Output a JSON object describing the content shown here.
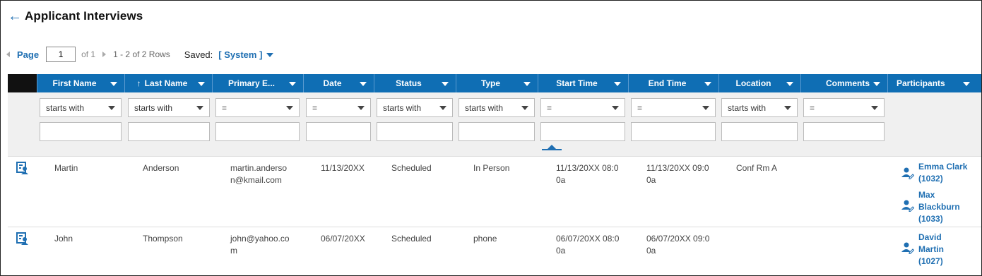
{
  "page": {
    "title": "Applicant Interviews",
    "back_icon": "arrow-left-icon"
  },
  "pager": {
    "page_label": "Page",
    "page_value": "1",
    "of_text": "of 1",
    "rows_text": "1 - 2 of 2 Rows",
    "saved_label": "Saved:",
    "saved_value": "[ System ]"
  },
  "columns": [
    {
      "label": "First Name"
    },
    {
      "label": "Last Name",
      "sort_icon": "↑"
    },
    {
      "label": "Primary E..."
    },
    {
      "label": "Date"
    },
    {
      "label": "Status"
    },
    {
      "label": "Type"
    },
    {
      "label": "Start Time"
    },
    {
      "label": "End Time"
    },
    {
      "label": "Location"
    },
    {
      "label": "Comments"
    },
    {
      "label": "Participants"
    }
  ],
  "filters": [
    "starts with",
    "starts with",
    "=",
    "=",
    "starts with",
    "starts with",
    "=",
    "=",
    "starts with",
    "="
  ],
  "rows": [
    {
      "first_name": "Martin",
      "last_name": "Anderson",
      "email_line1": "martin.anderso",
      "email_line2": "n@kmail.com",
      "date": "11/13/20XX",
      "status": "Scheduled",
      "type": "In Person",
      "start_line1": "11/13/20XX 08:0",
      "start_line2": "0a",
      "end_line1": "11/13/20XX 09:0",
      "end_line2": "0a",
      "location": "Conf Rm A",
      "comments": "",
      "participants": [
        {
          "line1": "Emma Clark",
          "line2": "(1032)",
          "line3": ""
        },
        {
          "line1": "Max",
          "line2": "Blackburn",
          "line3": "(1033)"
        }
      ]
    },
    {
      "first_name": "John",
      "last_name": "Thompson",
      "email_line1": "john@yahoo.co",
      "email_line2": "m",
      "date": "06/07/20XX",
      "status": "Scheduled",
      "type": "phone",
      "start_line1": "06/07/20XX 08:0",
      "start_line2": "0a",
      "end_line1": "06/07/20XX 09:0",
      "end_line2": "0a",
      "location": "",
      "comments": "",
      "participants": [
        {
          "line1": "David",
          "line2": "Martin",
          "line3": "(1027)"
        }
      ]
    }
  ],
  "colors": {
    "header_blue": "#0f6eb4",
    "link_blue": "#1f6fb2"
  },
  "icons": {
    "row_view": "person-view-icon",
    "participant": "person-edit-icon"
  }
}
